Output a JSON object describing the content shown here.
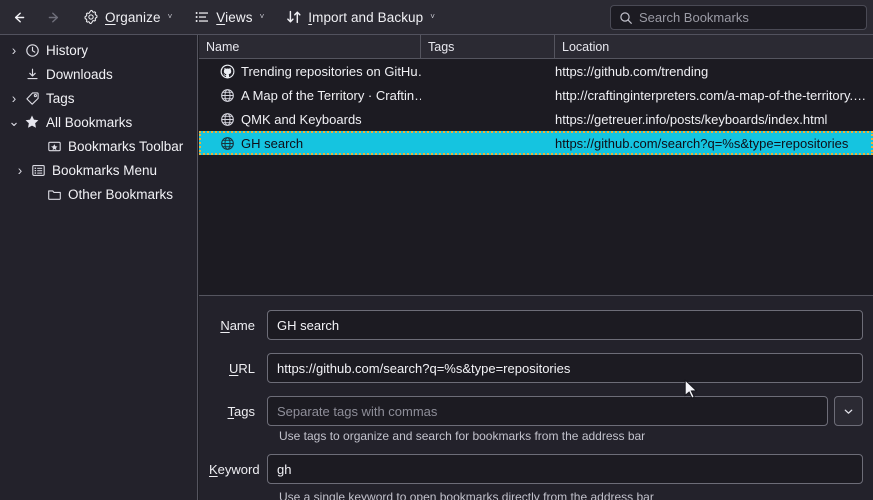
{
  "toolbar": {
    "back_icon": "arrow-left-icon",
    "forward_icon": "arrow-right-icon",
    "organize": {
      "label_pre": "O",
      "label_post": "rganize",
      "icon": "gear-icon",
      "caret": "˅"
    },
    "views": {
      "label_pre": "V",
      "label_post": "iews",
      "icon": "list-view-icon",
      "caret": "˅"
    },
    "import": {
      "label_pre": "I",
      "label_post": "mport and Backup",
      "icon": "import-export-icon",
      "caret": "˅"
    }
  },
  "search": {
    "placeholder": "Search Bookmarks",
    "icon": "search-icon"
  },
  "sidebar": {
    "items": [
      {
        "label": "History",
        "icon": "clock-icon",
        "twisty": "›",
        "indent": 0
      },
      {
        "label": "Downloads",
        "icon": "download-icon",
        "twisty": "",
        "indent": 0
      },
      {
        "label": "Tags",
        "icon": "tag-icon",
        "twisty": "›",
        "indent": 0
      },
      {
        "label": "All Bookmarks",
        "icon": "star-icon",
        "twisty": "⌄",
        "indent": 0
      },
      {
        "label": "Bookmarks Toolbar",
        "icon": "bookmarks-toolbar-icon",
        "twisty": "",
        "indent": 1
      },
      {
        "label": "Bookmarks Menu",
        "icon": "bookmarks-menu-icon",
        "twisty": "›",
        "indent": 1
      },
      {
        "label": "Other Bookmarks",
        "icon": "folder-icon",
        "twisty": "",
        "indent": 1
      }
    ]
  },
  "list": {
    "columns": [
      "Name",
      "Tags",
      "Location"
    ],
    "rows": [
      {
        "name": "Trending repositories on GitHu…",
        "tags": "",
        "location": "https://github.com/trending",
        "icon": "github-favicon",
        "selected": false
      },
      {
        "name": "A Map of the Territory · Craftin…",
        "tags": "",
        "location": "http://craftinginterpreters.com/a-map-of-the-territory.ht…",
        "icon": "globe-favicon",
        "selected": false
      },
      {
        "name": "QMK and Keyboards",
        "tags": "",
        "location": "https://getreuer.info/posts/keyboards/index.html",
        "icon": "globe-favicon",
        "selected": false
      },
      {
        "name": "GH search",
        "tags": "",
        "location": "https://github.com/search?q=%s&type=repositories",
        "icon": "globe-favicon",
        "selected": true
      }
    ]
  },
  "detail": {
    "name_label_pre": "N",
    "name_label_post": "ame",
    "name_value": "GH search",
    "url_label_pre": "U",
    "url_label_post": "RL",
    "url_value": "https://github.com/search?q=%s&type=repositories",
    "tags_label_pre": "T",
    "tags_label_post": "ags",
    "tags_placeholder": "Separate tags with commas",
    "tags_hint": "Use tags to organize and search for bookmarks from the address bar",
    "keyword_label_pre": "K",
    "keyword_label_post": "eyword",
    "keyword_value": "gh",
    "keyword_hint": "Use a single keyword to open bookmarks directly from the address bar",
    "dropdown_icon": "chevron-down-icon"
  },
  "colors": {
    "selection": "#15c4e0",
    "focus_outline": "#e8b33c",
    "toolbar_bg": "#2b2a33",
    "sidebar_bg": "#23222b",
    "list_bg": "#1c1b22"
  }
}
